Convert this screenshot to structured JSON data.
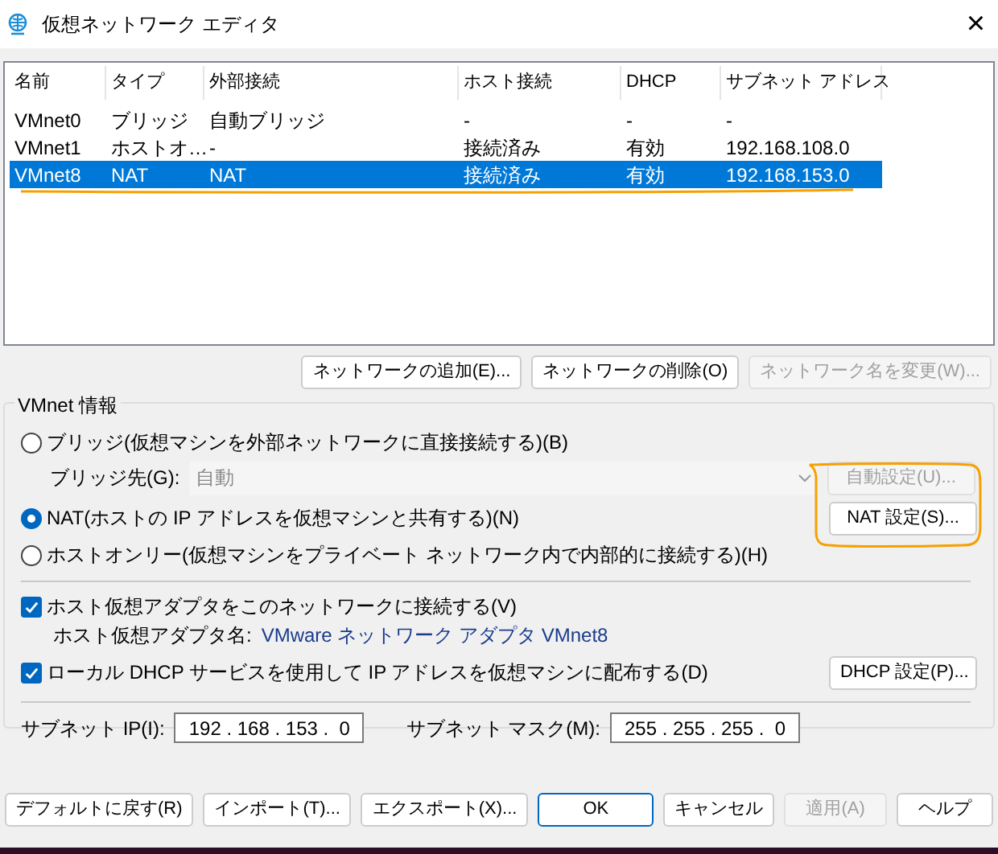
{
  "window": {
    "title": "仮想ネットワーク エディタ",
    "close": "×"
  },
  "table": {
    "columns": [
      "名前",
      "タイプ",
      "外部接続",
      "ホスト接続",
      "DHCP",
      "サブネット アドレス"
    ],
    "rows": [
      {
        "cells": [
          "VMnet0",
          "ブリッジ",
          "自動ブリッジ",
          "-",
          "-",
          "-"
        ],
        "selected": false
      },
      {
        "cells": [
          "VMnet1",
          "ホストオ…",
          "-",
          "接続済み",
          "有効",
          "192.168.108.0"
        ],
        "selected": false
      },
      {
        "cells": [
          "VMnet8",
          "NAT",
          "NAT",
          "接続済み",
          "有効",
          "192.168.153.0"
        ],
        "selected": true
      }
    ]
  },
  "network_buttons": [
    {
      "label": "ネットワークの追加(E)...",
      "disabled": false
    },
    {
      "label": "ネットワークの削除(O)",
      "disabled": false
    },
    {
      "label": "ネットワーク名を変更(W)...",
      "disabled": true
    }
  ],
  "vmnet_info": {
    "title": "VMnet 情報",
    "modes": [
      {
        "label": "ブリッジ(仮想マシンを外部ネットワークに直接接続する)(B)",
        "selected": false
      },
      {
        "label": "NAT(ホストの IP アドレスを仮想マシンと共有する)(N)",
        "selected": true
      },
      {
        "label": "ホストオンリー(仮想マシンをプライベート ネットワーク内で内部的に接続する)(H)",
        "selected": false
      }
    ],
    "bridge_to": {
      "label": "ブリッジ先(G):",
      "value": "自動",
      "disabled": true
    },
    "auto_settings_button": {
      "label": "自動設定(U)...",
      "disabled": true
    },
    "nat_settings_button": {
      "label": "NAT 設定(S)...",
      "disabled": false
    },
    "host_adapter": {
      "label": "ホスト仮想アダプタをこのネットワークに接続する(V)",
      "checked": true
    },
    "adapter_name": {
      "label": "ホスト仮想アダプタ名:",
      "value": "VMware ネットワーク アダプタ VMnet8"
    },
    "dhcp": {
      "label": "ローカル DHCP サービスを使用して IP アドレスを仮想マシンに配布する(D)",
      "checked": true
    },
    "dhcp_button": "DHCP 設定(P)...",
    "subnet_ip": {
      "label": "サブネット IP(I):",
      "value": "192 . 168 . 153 .  0"
    },
    "subnet_mask": {
      "label": "サブネット マスク(M):",
      "value": "255 . 255 . 255 .  0"
    }
  },
  "footer_buttons": [
    {
      "label": "デフォルトに戻す(R)",
      "disabled": false,
      "default": false
    },
    {
      "label": "インポート(T)...",
      "disabled": false,
      "default": false
    },
    {
      "label": "エクスポート(X)...",
      "disabled": false,
      "default": false
    },
    {
      "label": "OK",
      "disabled": false,
      "default": true
    },
    {
      "label": "キャンセル",
      "disabled": false,
      "default": false
    },
    {
      "label": "適用(A)",
      "disabled": true,
      "default": false
    },
    {
      "label": "ヘルプ",
      "disabled": false,
      "default": false
    }
  ]
}
